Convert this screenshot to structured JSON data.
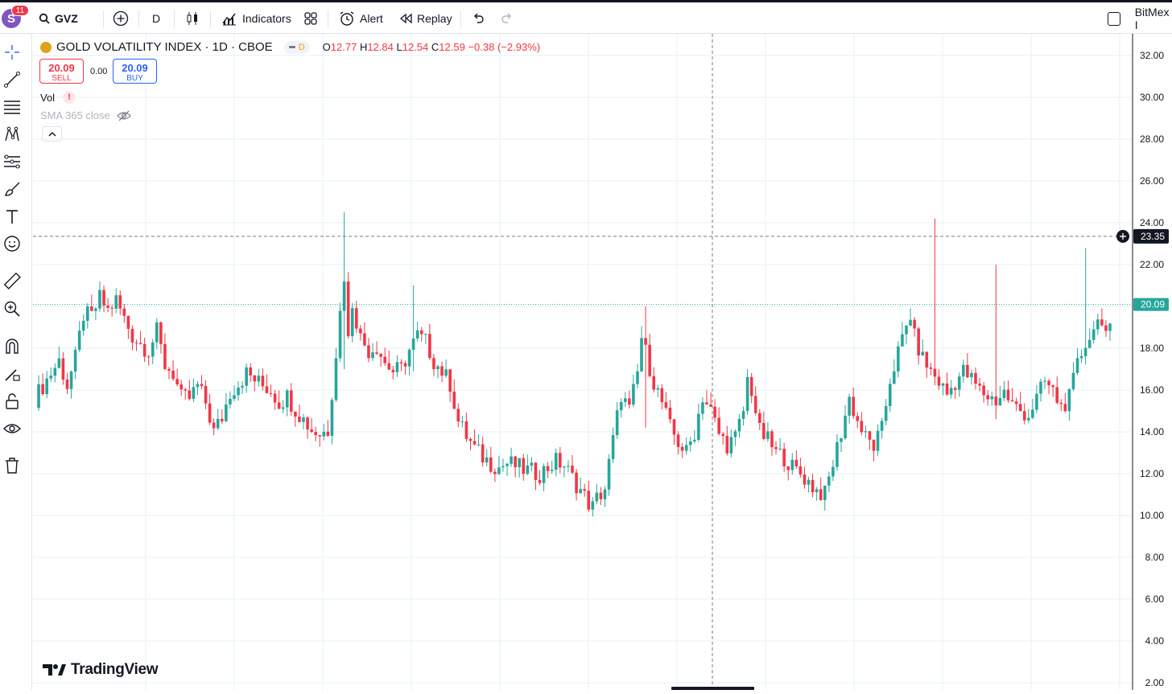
{
  "topbar": {
    "avatar_letter": "S",
    "avatar_badge": "11",
    "symbol": "GVZ",
    "interval": "D",
    "indicators_label": "Indicators",
    "alert_label": "Alert",
    "replay_label": "Replay",
    "right_label": "BitMex I"
  },
  "legend": {
    "title": "GOLD VOLATILITY INDEX · 1D · CBOE",
    "badge": "D",
    "o_label": "O",
    "o_value": "12.77",
    "h_label": "H",
    "h_value": "12.84",
    "l_label": "L",
    "l_value": "12.54",
    "c_label": "C",
    "c_value": "12.59",
    "change": "−0.38 (−2.93%)",
    "sell_price": "20.09",
    "sell_label": "SELL",
    "spread": "0.00",
    "buy_price": "20.09",
    "buy_label": "BUY",
    "vol_label": "Vol",
    "vol_warning": "!",
    "sma_label": "SMA 365 close"
  },
  "watermark": "TradingView",
  "colors": {
    "up": "#26a69a",
    "down": "#f23645",
    "accent": "#2962ff",
    "grid": "#e6f1f5"
  },
  "crosshair_price": "23.35",
  "last_price": "20.09",
  "chart_data": {
    "type": "candlestick",
    "y_axis_ticks": [
      "32.00",
      "30.00",
      "28.00",
      "26.00",
      "24.00",
      "22.00",
      "20.00",
      "18.00",
      "16.00",
      "14.00",
      "12.00",
      "10.00",
      "8.00",
      "6.00",
      "4.00",
      "2.00"
    ],
    "ylim": [
      2,
      32.6
    ],
    "crosshair_y": 23.35,
    "last_price": 20.09,
    "close_path": [
      [
        0,
        15.6
      ],
      [
        3,
        16.5
      ],
      [
        6,
        17.4
      ],
      [
        8,
        16.2
      ],
      [
        10,
        17.5
      ],
      [
        12,
        19.6
      ],
      [
        14,
        19.5
      ],
      [
        16,
        20.4
      ],
      [
        18,
        19.8
      ],
      [
        20,
        20.3
      ],
      [
        22,
        19.4
      ],
      [
        24,
        18.6
      ],
      [
        26,
        18.2
      ],
      [
        28,
        17.9
      ],
      [
        30,
        18.8
      ],
      [
        32,
        17.2
      ],
      [
        34,
        16.8
      ],
      [
        36,
        15.6
      ],
      [
        38,
        15.6
      ],
      [
        40,
        16.2
      ],
      [
        42,
        15.4
      ],
      [
        44,
        14.0
      ],
      [
        46,
        14.7
      ],
      [
        48,
        15.9
      ],
      [
        50,
        16.3
      ],
      [
        52,
        16.8
      ],
      [
        54,
        16.5
      ],
      [
        56,
        16.2
      ],
      [
        58,
        16.0
      ],
      [
        60,
        15.4
      ],
      [
        62,
        15.7
      ],
      [
        64,
        15.1
      ],
      [
        66,
        14.6
      ],
      [
        68,
        14.1
      ],
      [
        70,
        13.9
      ],
      [
        72,
        14.1
      ],
      [
        74,
        17.8
      ],
      [
        75,
        19.7
      ],
      [
        76,
        21.5
      ],
      [
        77,
        18.4
      ],
      [
        78,
        20.2
      ],
      [
        80,
        18.5
      ],
      [
        82,
        17.9
      ],
      [
        84,
        18.1
      ],
      [
        86,
        17.3
      ],
      [
        88,
        16.9
      ],
      [
        90,
        17.0
      ],
      [
        92,
        17.9
      ],
      [
        94,
        18.6
      ],
      [
        96,
        18.3
      ],
      [
        98,
        17.4
      ],
      [
        100,
        16.9
      ],
      [
        102,
        16.3
      ],
      [
        104,
        14.5
      ],
      [
        106,
        13.8
      ],
      [
        108,
        13.2
      ],
      [
        110,
        12.8
      ],
      [
        112,
        12.5
      ],
      [
        114,
        12.3
      ],
      [
        116,
        12.5
      ],
      [
        118,
        12.4
      ],
      [
        120,
        12.2
      ],
      [
        122,
        12.1
      ],
      [
        124,
        12.0
      ],
      [
        126,
        12.3
      ],
      [
        128,
        12.6
      ],
      [
        130,
        12.4
      ],
      [
        132,
        11.8
      ],
      [
        134,
        11.2
      ],
      [
        136,
        10.6
      ],
      [
        137,
        10.4
      ],
      [
        138,
        10.8
      ],
      [
        140,
        11.3
      ],
      [
        142,
        13.6
      ],
      [
        144,
        15.8
      ],
      [
        146,
        15.0
      ],
      [
        148,
        16.8
      ],
      [
        149,
        18.5
      ],
      [
        150,
        17.8
      ],
      [
        152,
        16.4
      ],
      [
        154,
        15.4
      ],
      [
        156,
        14.2
      ],
      [
        158,
        13.5
      ],
      [
        160,
        13.0
      ],
      [
        162,
        14.0
      ],
      [
        164,
        15.7
      ],
      [
        166,
        15.0
      ],
      [
        168,
        13.9
      ],
      [
        170,
        13.4
      ],
      [
        172,
        13.7
      ],
      [
        174,
        15.0
      ],
      [
        175,
        16.5
      ],
      [
        176,
        16.0
      ],
      [
        178,
        14.0
      ],
      [
        180,
        13.6
      ],
      [
        182,
        13.0
      ],
      [
        184,
        12.8
      ],
      [
        186,
        12.3
      ],
      [
        188,
        12.0
      ],
      [
        190,
        11.6
      ],
      [
        192,
        11.2
      ],
      [
        194,
        11.0
      ],
      [
        196,
        12.5
      ],
      [
        198,
        14.0
      ],
      [
        200,
        15.6
      ],
      [
        202,
        14.5
      ],
      [
        204,
        13.7
      ],
      [
        206,
        13.3
      ],
      [
        208,
        14.1
      ],
      [
        210,
        16.5
      ],
      [
        212,
        17.8
      ],
      [
        214,
        19.0
      ],
      [
        215,
        19.6
      ],
      [
        216,
        18.5
      ],
      [
        218,
        17.5
      ],
      [
        220,
        16.9
      ],
      [
        222,
        16.4
      ],
      [
        224,
        15.8
      ],
      [
        226,
        16.4
      ],
      [
        228,
        16.9
      ],
      [
        230,
        16.5
      ],
      [
        232,
        16.0
      ],
      [
        234,
        15.7
      ],
      [
        236,
        15.5
      ],
      [
        238,
        15.9
      ],
      [
        240,
        15.3
      ],
      [
        242,
        15.0
      ],
      [
        244,
        14.8
      ],
      [
        246,
        15.6
      ],
      [
        248,
        16.4
      ],
      [
        250,
        15.9
      ],
      [
        252,
        15.2
      ],
      [
        254,
        15.6
      ],
      [
        256,
        17.2
      ],
      [
        258,
        18.3
      ],
      [
        260,
        18.8
      ],
      [
        261,
        19.8
      ],
      [
        262,
        19.0
      ],
      [
        263,
        18.4
      ],
      [
        264,
        18.8
      ]
    ],
    "wick_spikes": [
      {
        "t": 76,
        "high": 24.5,
        "low": 17.0
      },
      {
        "t": 93,
        "high": 21.0,
        "low": 16.9
      },
      {
        "t": 221,
        "high": 24.2,
        "low": 19.6
      },
      {
        "t": 236,
        "high": 22.0,
        "low": 14.6
      },
      {
        "t": 150,
        "high": 20.0,
        "low": 14.2
      },
      {
        "t": 258,
        "high": 22.8,
        "low": 20.2
      }
    ]
  }
}
